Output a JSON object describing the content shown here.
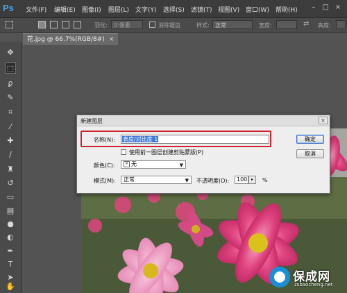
{
  "app": {
    "logo": "Ps"
  },
  "menu": [
    "文件(F)",
    "编辑(E)",
    "图像(I)",
    "图层(L)",
    "文字(Y)",
    "选择(S)",
    "滤镜(T)",
    "视图(V)",
    "窗口(W)",
    "帮助(H)"
  ],
  "options_bar": {
    "feather_label": "羽化:",
    "feather_value": "0 像素",
    "antialias_label": "消除锯齿",
    "style_label": "样式:",
    "style_value": "正常",
    "width_label": "宽度:",
    "height_label": "高度:"
  },
  "document_tab": {
    "title": "花.jpg @ 66.7%(RGB/8#)",
    "close": "×"
  },
  "dialog": {
    "title": "新建图层",
    "name_label": "名称(N):",
    "name_value": "表度/对比度 1",
    "clip_label": "使用前一图层创建剪贴蒙版(P)",
    "color_label": "颜色(C):",
    "color_value": "无",
    "mode_label": "模式(M):",
    "mode_value": "正常",
    "opacity_label": "不透明度(O):",
    "opacity_value": "100",
    "opacity_unit": "%",
    "ok_label": "确定",
    "cancel_label": "取消"
  },
  "watermark": {
    "title": "保成网",
    "url": "zsbaocheng.net"
  },
  "colors": {
    "highlight": "#d0222d",
    "accent": "#4aa3df",
    "flower": "#e0457f"
  }
}
